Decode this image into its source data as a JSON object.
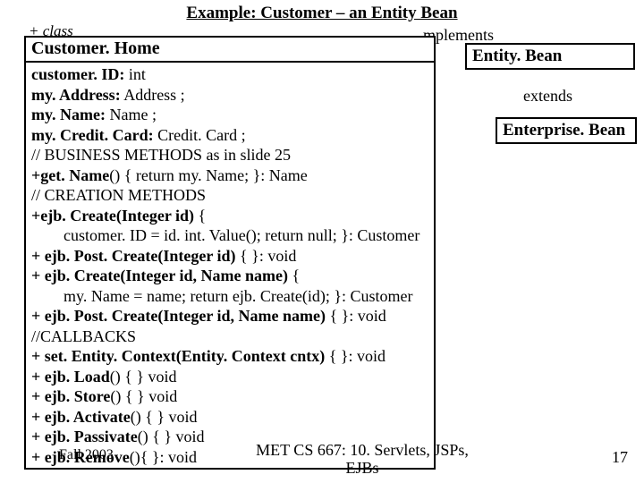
{
  "title": "Example: Customer – an Entity Bean",
  "plus_class": "+ class",
  "implements_label": "mplements",
  "extends_label": "extends",
  "page_number": "17",
  "footer_course_line1": "MET CS 667: 10. Servlets, JSPs,",
  "footer_course_line2": "EJBs",
  "fall_label": "Fall 2003",
  "box_entitybean": "Entity. Bean",
  "box_enterprisebean": "Enterprise. Bean",
  "main_name": "Customer. Home",
  "body": {
    "l01a": "customer. ID:",
    "l01b": " int",
    "l02a": "my. Address:",
    "l02b": " Address ;",
    "l03a": "my. Name:",
    "l03b": " Name ;",
    "l04a": "my. Credit. Card:",
    "l04b": " Credit. Card ;",
    "l05": "// BUSINESS METHODS as in slide 25",
    "l06a": "+get. Name",
    "l06b": "() { return my. Name; }: Name",
    "l07": "// CREATION METHODS",
    "l08a": "+ejb. Create(Integer id)",
    "l08b": " {",
    "l09": "        customer. ID = id. int. Value(); return null; }: Customer",
    "l10a": "+ ejb. Post. Create(Integer id)",
    "l10b": " { }: void",
    "l11a": "+ ejb. Create(Integer id, Name name)",
    "l11b": " {",
    "l12": "        my. Name = name; return ejb. Create(id); }: Customer",
    "l13a": "+ ejb. Post. Create(Integer id, Name name)",
    "l13b": " { }: void",
    "l14": "//CALLBACKS",
    "l15a": "+ set. Entity. Context(Entity. Context cntx)",
    "l15b": " { }: void",
    "l16a": "+ ejb. Load",
    "l16b": "() { } void",
    "l17a": "+ ejb. Store",
    "l17b": "() { } void",
    "l18a": "+ ejb. Activate",
    "l18b": "() { } void",
    "l19a": "+ ejb. Passivate",
    "l19b": "() { } void",
    "l20a": "+ ejb. Remove",
    "l20b": "(){ }: void"
  }
}
